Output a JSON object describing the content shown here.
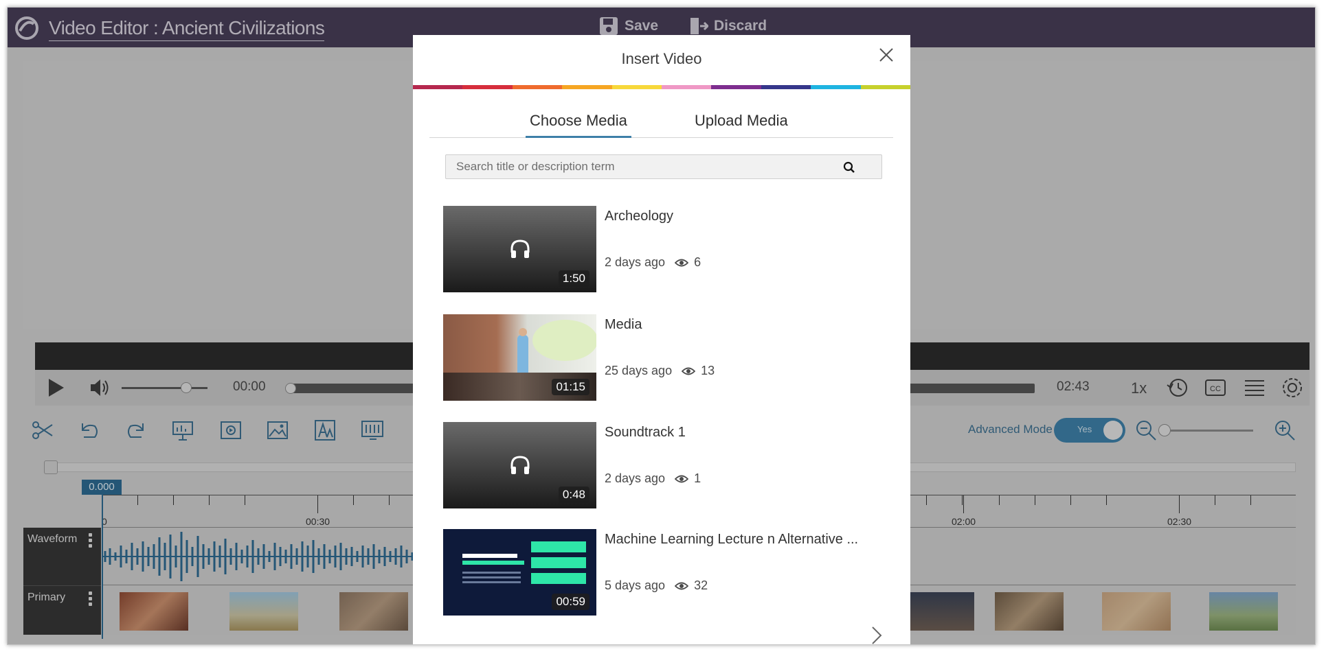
{
  "app": {
    "title": "Video Editor : Ancient Civilizations",
    "save_label": "Save",
    "discard_label": "Discard"
  },
  "player": {
    "current_time": "00:00",
    "total_time": "02:43",
    "rate": "1x"
  },
  "toolbar": {
    "advanced_mode_label": "Advanced Mode",
    "advanced_mode_value": "Yes"
  },
  "timeline": {
    "playhead": "0.000",
    "ticks": [
      "0",
      "00:30",
      "02:00",
      "02:30"
    ],
    "tracks": [
      "Waveform",
      "Primary"
    ]
  },
  "modal": {
    "title": "Insert Video",
    "tabs": [
      "Choose Media",
      "Upload Media"
    ],
    "active_tab": "Choose Media",
    "search_placeholder": "Search title or description term",
    "rainbow_colors": [
      "#b5284e",
      "#d62e3c",
      "#ef6b2e",
      "#f6a623",
      "#f7d83b",
      "#ef98c5",
      "#7e2e8f",
      "#36378b",
      "#1fb4e1",
      "#c7d12d"
    ],
    "items": [
      {
        "title": "Archeology",
        "duration": "1:50",
        "age": "2 days ago",
        "views": "6",
        "kind": "audio"
      },
      {
        "title": "Media",
        "duration": "01:15",
        "age": "25 days ago",
        "views": "13",
        "kind": "video"
      },
      {
        "title": "Soundtrack 1",
        "duration": "0:48",
        "age": "2 days ago",
        "views": "1",
        "kind": "audio"
      },
      {
        "title": "Machine Learning Lecture n Alternative ...",
        "duration": "00:59",
        "age": "5 days ago",
        "views": "32",
        "kind": "slides"
      }
    ]
  }
}
